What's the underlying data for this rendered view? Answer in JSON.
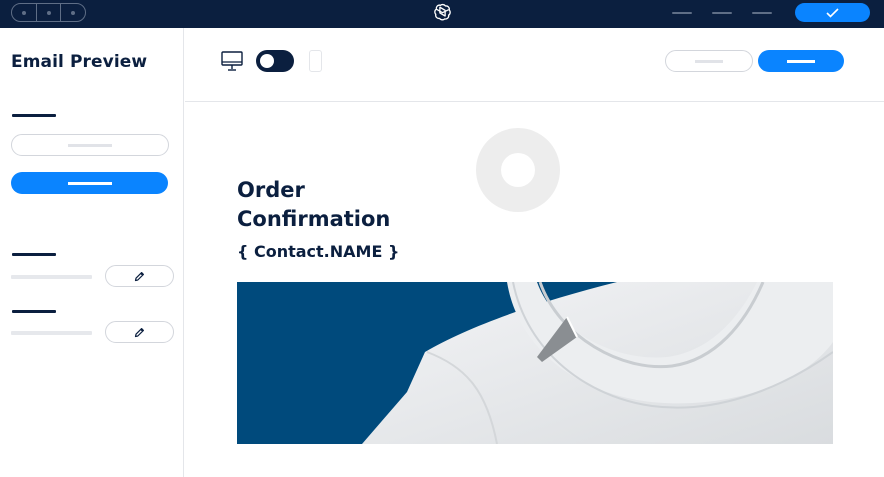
{
  "sidebar": {
    "title": "Email Preview"
  },
  "email": {
    "title": "Order Confirmation",
    "contact_placeholder": "{ Contact.NAME }"
  },
  "colors": {
    "topbar": "#0b1f3f",
    "accent": "#0a84ff",
    "hero_background": "#004a7c",
    "text_dark": "#0b1f3f"
  },
  "icons": {
    "app_logo": "openai-knot-icon",
    "confirm": "checkmark-icon",
    "desktop_view": "monitor-icon",
    "mobile_view": "phone-icon",
    "edit": "pencil-icon"
  }
}
